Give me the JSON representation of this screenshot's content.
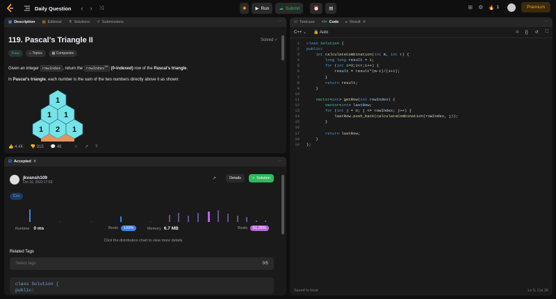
{
  "topbar": {
    "title": "Daily Question",
    "run": "Run",
    "submit": "Submit",
    "streak": "1",
    "premium": "Premium"
  },
  "left_tabs": [
    "Description",
    "Editorial",
    "Solutions",
    "Submissions"
  ],
  "problem": {
    "title": "119. Pascal's Triangle II",
    "status": "Solved",
    "tags": [
      "Easy",
      "Topics",
      "Companies"
    ],
    "desc1_a": "Given an integer ",
    "desc1_code1": "rowIndex",
    "desc1_b": ", return the ",
    "desc1_code2": "rowIndex",
    "desc1_sup": "th",
    "desc1_c": " (0-indexed)",
    "desc1_d": " row of the ",
    "desc1_e": "Pascal's triangle",
    "desc1_f": ".",
    "desc2_a": "In ",
    "desc2_b": "Pascal's triangle",
    "desc2_c": ", each number is the sum of the two numbers directly above it as shown:",
    "triangle": [
      [
        "1"
      ],
      [
        "1",
        "1"
      ],
      [
        "1",
        "2",
        "1"
      ]
    ],
    "likes": "4.4K",
    "dislikes": "315",
    "comments": "48"
  },
  "result": {
    "tab": "Accepted",
    "user": "jkvansh109",
    "date": "Oct 16, 2023 17:52",
    "details": "Details",
    "solution_btn": "Solution",
    "lang": "C++",
    "runtime_label": "Runtime",
    "runtime_value": "0 ms",
    "runtime_beats": "100%",
    "memory_label": "Memory",
    "memory_value": "6.7 MB",
    "memory_beats": "51.35%",
    "beats_label": "Beats",
    "hint": "Click the distribution chart to view more details",
    "related_tags": "Related Tags",
    "select_placeholder": "Select tags",
    "count": "0/5",
    "code_preview": [
      "class Solution {",
      "public:"
    ]
  },
  "right_tabs": [
    "Testcase",
    "Code",
    "Result"
  ],
  "editor": {
    "lang": "C++",
    "mode": "Auto",
    "saved": "Saved to local",
    "pos": "Ln 5, Col 26",
    "lines": [
      {
        "n": "1",
        "html": "<span class='kw'>class</span> <span class='ty'>Solution</span> {"
      },
      {
        "n": "2",
        "html": "<span class='kw'>public</span>:"
      },
      {
        "n": "3",
        "html": "    <span class='kw'>int</span> <span class='fn'>calculateCombination</span>(<span class='kw'>int</span> <span class='id'>m</span>, <span class='kw'>int</span> <span class='id'>r</span>) {"
      },
      {
        "n": "4",
        "html": "        <span class='kw'>long long</span> <span class='id'>result</span> = <span class='nm'>1</span>;"
      },
      {
        "n": "5",
        "html": "        <span class='kw'>for</span> (<span class='kw'>int</span> <span class='id'>i</span>=<span class='nm'>0</span>;i&lt;r;i++) {"
      },
      {
        "n": "6",
        "html": "            <span class='id'>result</span> = result*(m-i)/(i+<span class='nm'>1</span>);"
      },
      {
        "n": "7",
        "html": "        }"
      },
      {
        "n": "8",
        "html": "        <span class='kw'>return</span> result;"
      },
      {
        "n": "9",
        "html": "    }"
      },
      {
        "n": "10",
        "html": ""
      },
      {
        "n": "11",
        "html": "    <span class='ty'>vector</span>&lt;<span class='kw'>int</span>&gt; <span class='fn'>getRow</span>(<span class='kw'>int</span> <span class='id'>rowIndex</span>) {"
      },
      {
        "n": "12",
        "html": "        <span class='ty'>vector</span>&lt;<span class='kw'>int</span>&gt; <span class='id'>lastRow</span>;"
      },
      {
        "n": "13",
        "html": "        <span class='kw'>for</span> (<span class='kw'>int</span> <span class='id'>j</span> = <span class='nm'>0</span>; j &lt;= rowIndex; j++) {"
      },
      {
        "n": "14",
        "html": "            lastRow.<span class='fn'>push_back</span>(<span class='fn'>calculateCombination</span>(rowIndex, j));"
      },
      {
        "n": "15",
        "html": "        }"
      },
      {
        "n": "16",
        "html": ""
      },
      {
        "n": "17",
        "html": "        <span class='kw'>return</span> lastRow;"
      },
      {
        "n": "18",
        "html": "    }"
      },
      {
        "n": "19",
        "html": "};"
      }
    ]
  }
}
